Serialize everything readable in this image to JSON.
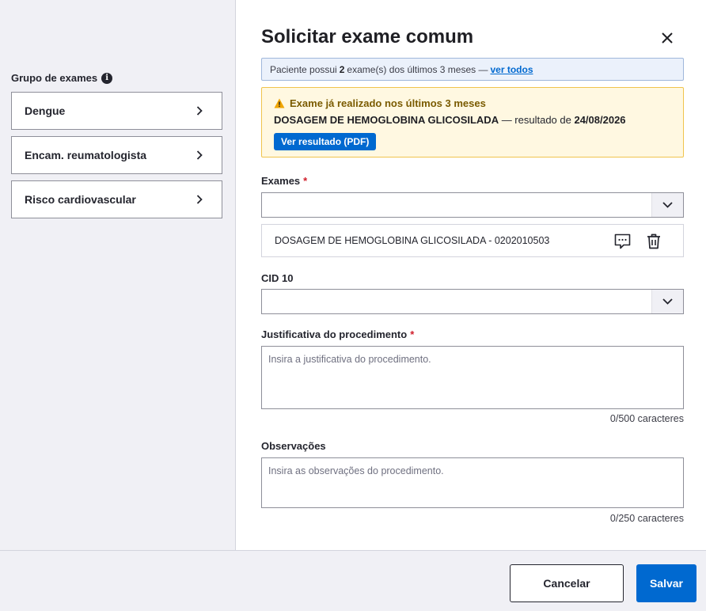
{
  "sidebar": {
    "group_label": "Grupo de exames",
    "items": [
      {
        "label": "Dengue"
      },
      {
        "label": "Encam. reumatologista"
      },
      {
        "label": "Risco cardiovascular"
      }
    ]
  },
  "modal": {
    "title": "Solicitar exame comum",
    "info_banner": {
      "prefix": "Paciente possui",
      "count": "2",
      "suffix": "exame(s) dos últimos 3 meses —",
      "link": "ver todos"
    },
    "warning": {
      "title": "Exame já realizado nos últimos 3 meses",
      "exam_name": "DOSAGEM DE HEMOGLOBINA GLICOSILADA",
      "result_text": " — resultado de ",
      "result_date": "24/08/2026",
      "button": "Ver resultado (PDF)"
    },
    "exams": {
      "label": "Exames",
      "required_mark": "*",
      "value": "",
      "selected_items": [
        {
          "label": "DOSAGEM DE HEMOGLOBINA GLICOSILADA - 0202010503"
        }
      ]
    },
    "cid": {
      "label": "CID 10",
      "value": ""
    },
    "justification": {
      "label": "Justificativa do procedimento",
      "required_mark": "*",
      "placeholder": "Insira a justificativa do procedimento.",
      "counter": "0/500 caracteres"
    },
    "observations": {
      "label": "Observações",
      "placeholder": "Insira as observações do procedimento.",
      "counter": "0/250 caracteres"
    }
  },
  "footer": {
    "cancel_label": "Cancelar",
    "save_label": "Salvar"
  },
  "colors": {
    "primary": "#0069d0",
    "warning_bg": "#fff8e1",
    "warning_border": "#f0c44c",
    "info_bg": "#ebf1fb",
    "required": "#d01e2b"
  },
  "icons": {
    "info": "info-icon",
    "chevron_right": "chevron-right-icon",
    "close": "close-icon",
    "warning": "warning-icon",
    "chevron_down": "chevron-down-icon",
    "comment": "comment-icon",
    "trash": "trash-icon"
  }
}
